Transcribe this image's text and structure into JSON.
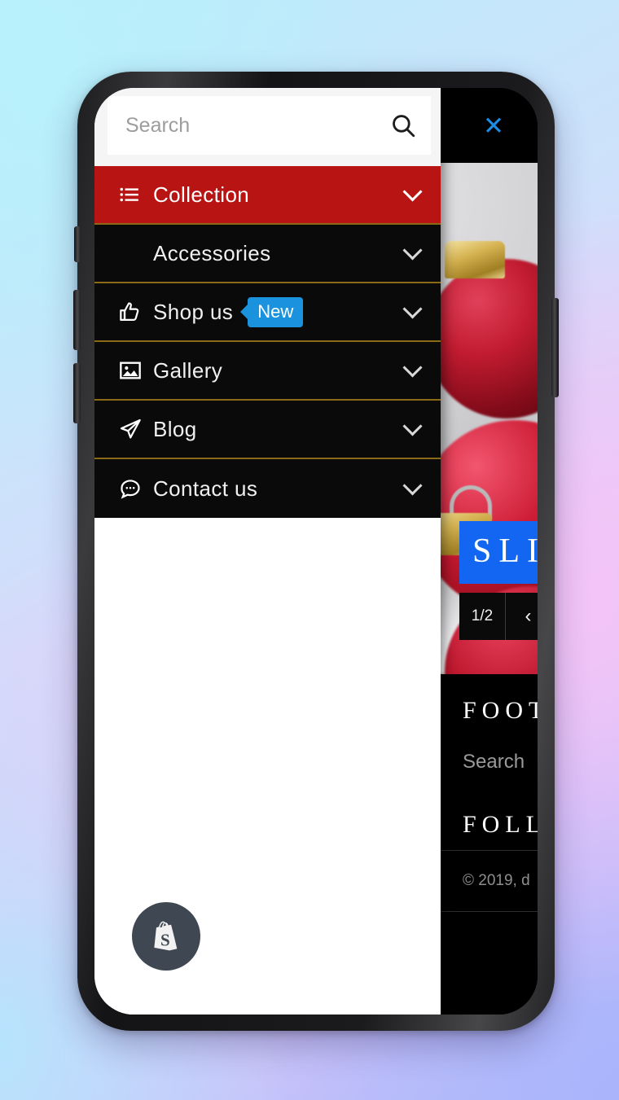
{
  "device": {
    "name": "smartphone-mockup"
  },
  "drawer": {
    "search": {
      "placeholder": "Search",
      "value": "",
      "icon": "search-icon",
      "button_label": ""
    },
    "menu_items": [
      {
        "label": "Collection",
        "icon": "list-ul-icon",
        "active": true,
        "badge": null,
        "chevron": "chevron-down-icon"
      },
      {
        "label": "Accessories",
        "icon": null,
        "active": false,
        "badge": null,
        "chevron": "chevron-down-icon"
      },
      {
        "label": "Shop us",
        "icon": "thumbs-up-icon",
        "active": false,
        "badge": "New",
        "chevron": "chevron-down-icon"
      },
      {
        "label": "Gallery",
        "icon": "image-icon",
        "active": false,
        "badge": null,
        "chevron": "chevron-down-icon"
      },
      {
        "label": "Blog",
        "icon": "paper-plane-icon",
        "active": false,
        "badge": null,
        "chevron": "chevron-down-icon"
      },
      {
        "label": "Contact us",
        "icon": "comment-dots-icon",
        "active": false,
        "badge": null,
        "chevron": "chevron-down-icon"
      }
    ],
    "shopify_badge": {
      "icon": "shopify-bag-icon"
    }
  },
  "site": {
    "close_button": {
      "label": "✕",
      "icon": "close-icon"
    },
    "hero": {
      "slide_caption": "SLI",
      "slider": {
        "counter": "1/2",
        "prev": "‹",
        "next": "›"
      }
    },
    "footer": {
      "title": "FOOT",
      "link": "Search",
      "title2": "FOLLO",
      "copyright": "© 2019, d"
    }
  },
  "colors": {
    "accent_red": "#b81414",
    "badge_blue": "#1a92dd",
    "close_blue": "#1a8fe8",
    "divider_gold": "#8a6a17",
    "slide_blue": "#1266f1",
    "menu_black": "#0a0a0a",
    "shopify_gray": "#3f4852"
  }
}
